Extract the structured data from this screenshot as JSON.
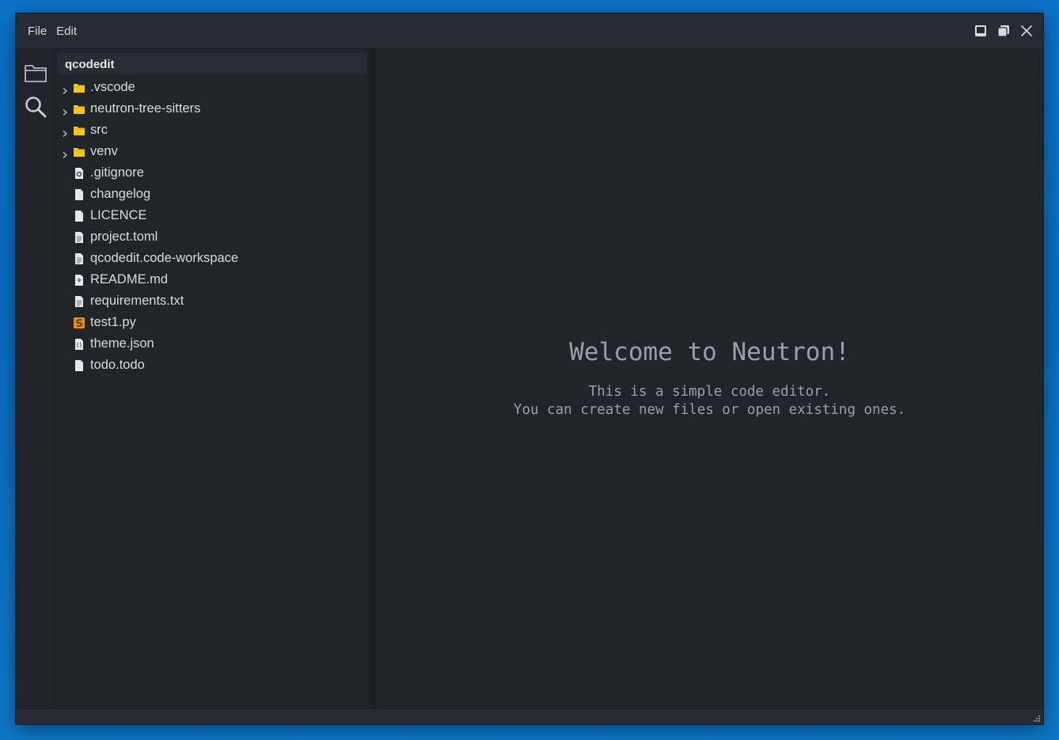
{
  "menu": {
    "file": "File",
    "edit": "Edit"
  },
  "window_controls": [
    "minimize-icon",
    "restore-icon",
    "close-icon"
  ],
  "activity_bar": [
    "folder-icon",
    "search-icon"
  ],
  "explorer": {
    "title": "qcodedit",
    "items": [
      {
        "label": ".vscode",
        "type": "folder",
        "icon": "folder-icon"
      },
      {
        "label": "neutron-tree-sitters",
        "type": "folder",
        "icon": "folder-icon"
      },
      {
        "label": "src",
        "type": "folder",
        "icon": "folder-icon"
      },
      {
        "label": "venv",
        "type": "folder",
        "icon": "folder-icon"
      },
      {
        "label": ".gitignore",
        "type": "file",
        "icon": "gear-file-icon"
      },
      {
        "label": "changelog",
        "type": "file",
        "icon": "file-icon"
      },
      {
        "label": "LICENCE",
        "type": "file",
        "icon": "file-icon"
      },
      {
        "label": "project.toml",
        "type": "file",
        "icon": "text-file-icon"
      },
      {
        "label": "qcodedit.code-workspace",
        "type": "file",
        "icon": "text-file-icon"
      },
      {
        "label": "README.md",
        "type": "file",
        "icon": "markdown-file-icon"
      },
      {
        "label": "requirements.txt",
        "type": "file",
        "icon": "text-file-icon"
      },
      {
        "label": "test1.py",
        "type": "file",
        "icon": "python-file-icon"
      },
      {
        "label": "theme.json",
        "type": "file",
        "icon": "json-file-icon"
      },
      {
        "label": "todo.todo",
        "type": "file",
        "icon": "file-icon"
      }
    ]
  },
  "welcome": {
    "title": "Welcome to Neutron!",
    "line1": "This is a simple code editor.",
    "line2": "You can create new files or open existing ones."
  },
  "colors": {
    "folder": "#f5c518",
    "python": "#f08c00",
    "background": "#21252b",
    "text": "#d7dae0"
  }
}
